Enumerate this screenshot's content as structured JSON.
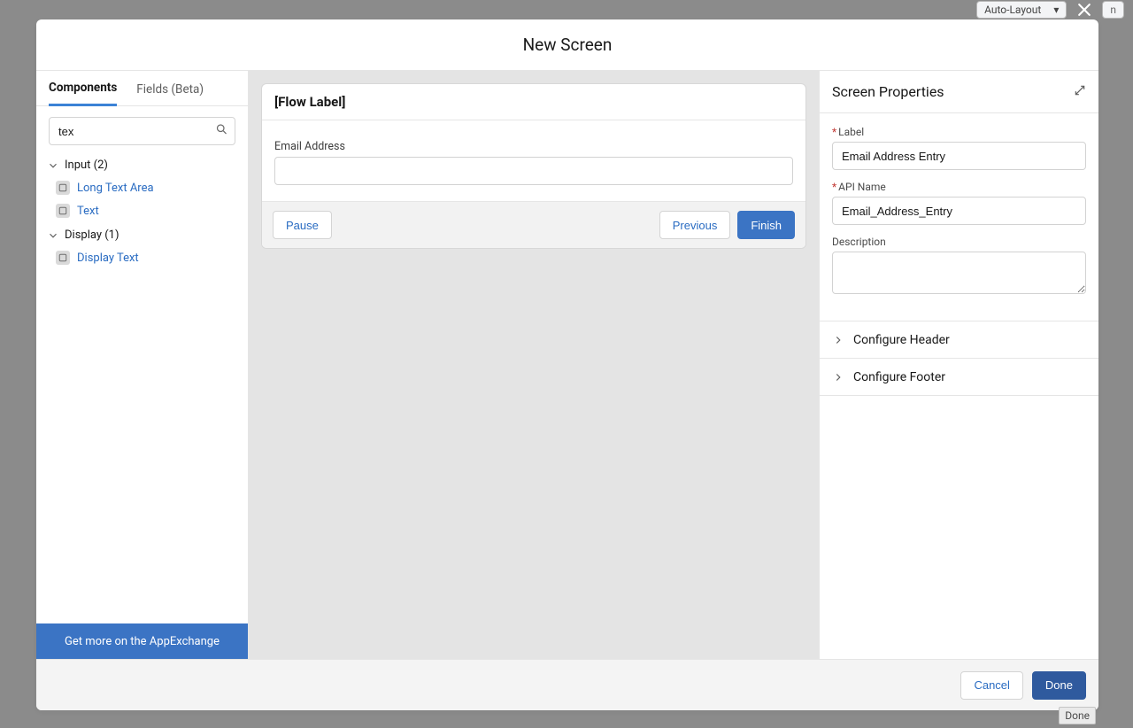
{
  "background": {
    "layout_select": "Auto-Layout",
    "hidden_btn": "n"
  },
  "modal": {
    "title": "New Screen",
    "footer": {
      "cancel": "Cancel",
      "done": "Done"
    }
  },
  "left": {
    "tabs": {
      "components": "Components",
      "fields": "Fields (Beta)"
    },
    "search_value": "tex",
    "groups": {
      "input": {
        "label": "Input (2)",
        "items": [
          "Long Text Area",
          "Text"
        ]
      },
      "display": {
        "label": "Display (1)",
        "items": [
          "Display Text"
        ]
      }
    },
    "appexchange": "Get more on the AppExchange"
  },
  "canvas": {
    "flow_label": "[Flow Label]",
    "field_label": "Email Address",
    "field_value": "",
    "buttons": {
      "pause": "Pause",
      "previous": "Previous",
      "finish": "Finish"
    }
  },
  "right": {
    "title": "Screen Properties",
    "label": {
      "caption": "Label",
      "value": "Email Address Entry"
    },
    "api": {
      "caption": "API Name",
      "value": "Email_Address_Entry"
    },
    "desc": {
      "caption": "Description",
      "value": ""
    },
    "accordion": {
      "header": "Configure Header",
      "footer": "Configure Footer"
    }
  },
  "tooltip": "Done"
}
